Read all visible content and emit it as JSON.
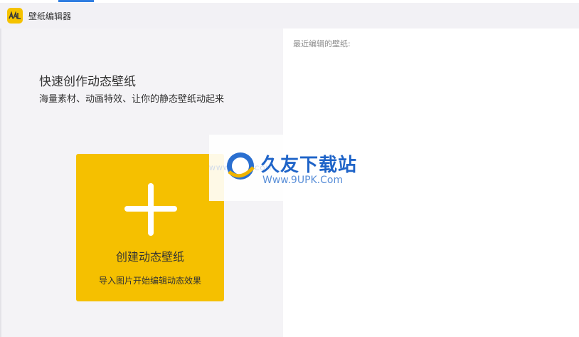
{
  "app": {
    "title": "壁纸编辑器"
  },
  "main": {
    "heading": "快速创作动态壁纸",
    "subheading": "海量素材、动画特效、让你的静态壁纸动起来",
    "create_card": {
      "title": "创建动态壁纸",
      "subtitle": "导入图片开始编辑动态效果"
    }
  },
  "recent": {
    "label": "最近编辑的壁纸:"
  },
  "watermark": {
    "site_name": "久友下载站",
    "url": "Www.9UPK.Com",
    "url_small": "WWW.9UPK.COM"
  },
  "colors": {
    "accent": "#f5c000",
    "titlebar": "#f2f1f5",
    "left_panel": "#f4f3f6",
    "watermark_blue": "#1f64c8"
  },
  "icons": {
    "logo": "wallpaper-app-logo-icon",
    "create": "plus-icon",
    "watermark": "globe-logo-icon"
  }
}
